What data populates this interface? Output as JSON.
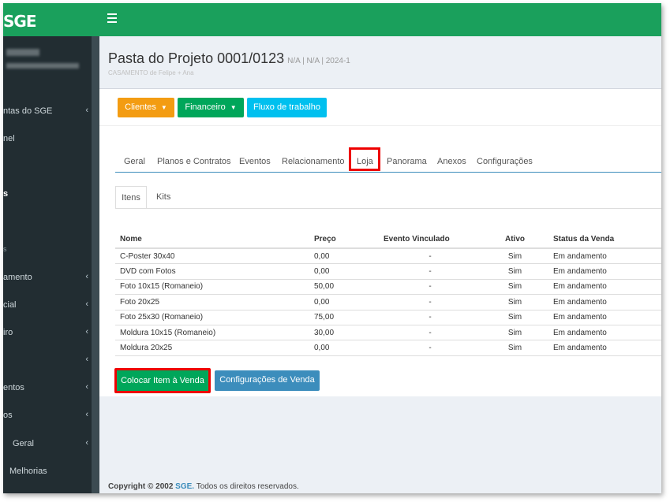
{
  "header": {
    "logo": "SGE",
    "menu_toggle": "menu-toggle"
  },
  "sidebar": {
    "items": [
      {
        "label": "ntas do SGE",
        "chevron": "‹"
      },
      {
        "label": "nel",
        "chevron": ""
      },
      {
        "label": "s",
        "chevron": ""
      },
      {
        "label": "s",
        "chevron": ""
      },
      {
        "label": "amento",
        "chevron": "‹"
      },
      {
        "label": "cial",
        "chevron": "‹"
      },
      {
        "label": "iro",
        "chevron": "‹"
      },
      {
        "label": "",
        "chevron": "‹"
      },
      {
        "label": "entos",
        "chevron": "‹"
      },
      {
        "label": "os",
        "chevron": "‹"
      },
      {
        "label": "Geral",
        "chevron": "‹"
      },
      {
        "label": "Melhorias",
        "chevron": ""
      }
    ]
  },
  "page": {
    "title": "Pasta do Projeto 0001/0123",
    "meta": "N/A | N/A | 2024-1",
    "subtitle": "CASAMENTO de Felipe + Ana"
  },
  "actions": {
    "clientes": "Clientes",
    "financeiro": "Financeiro",
    "fluxo": "Fluxo de trabalho"
  },
  "tabs": [
    "Geral",
    "Planos e Contratos",
    "Eventos",
    "Relacionamento",
    "Loja",
    "Panorama",
    "Anexos",
    "Configurações"
  ],
  "subtabs": [
    "Itens",
    "Kits"
  ],
  "table": {
    "headers": [
      "Nome",
      "Preço",
      "Evento Vinculado",
      "Ativo",
      "Status da Venda"
    ],
    "rows": [
      [
        "C-Poster 30x40",
        "0,00",
        "-",
        "Sim",
        "Em andamento"
      ],
      [
        "DVD com Fotos",
        "0,00",
        "-",
        "Sim",
        "Em andamento"
      ],
      [
        "Foto 10x15 (Romaneio)",
        "50,00",
        "-",
        "Sim",
        "Em andamento"
      ],
      [
        "Foto 20x25",
        "0,00",
        "-",
        "Sim",
        "Em andamento"
      ],
      [
        "Foto 25x30 (Romaneio)",
        "75,00",
        "-",
        "Sim",
        "Em andamento"
      ],
      [
        "Moldura 10x15 (Romaneio)",
        "30,00",
        "-",
        "Sim",
        "Em andamento"
      ],
      [
        "Moldura 20x25",
        "0,00",
        "-",
        "Sim",
        "Em andamento"
      ]
    ]
  },
  "buttons": {
    "colocar": "Colocar Item à Venda",
    "config_venda": "Configurações de Venda"
  },
  "footer": {
    "copyright": "Copyright © 2002",
    "brand": "SGE.",
    "rights": "Todos os direitos reservados."
  },
  "colors": {
    "brand_green": "#1aa05c",
    "sidebar_dark": "#222d32",
    "orange": "#f39c12",
    "green_button": "#00a65a",
    "cyan": "#00c0ef",
    "blue": "#3c8dbc",
    "highlight_red": "#e00000",
    "status_green": "#2a9b2a"
  }
}
